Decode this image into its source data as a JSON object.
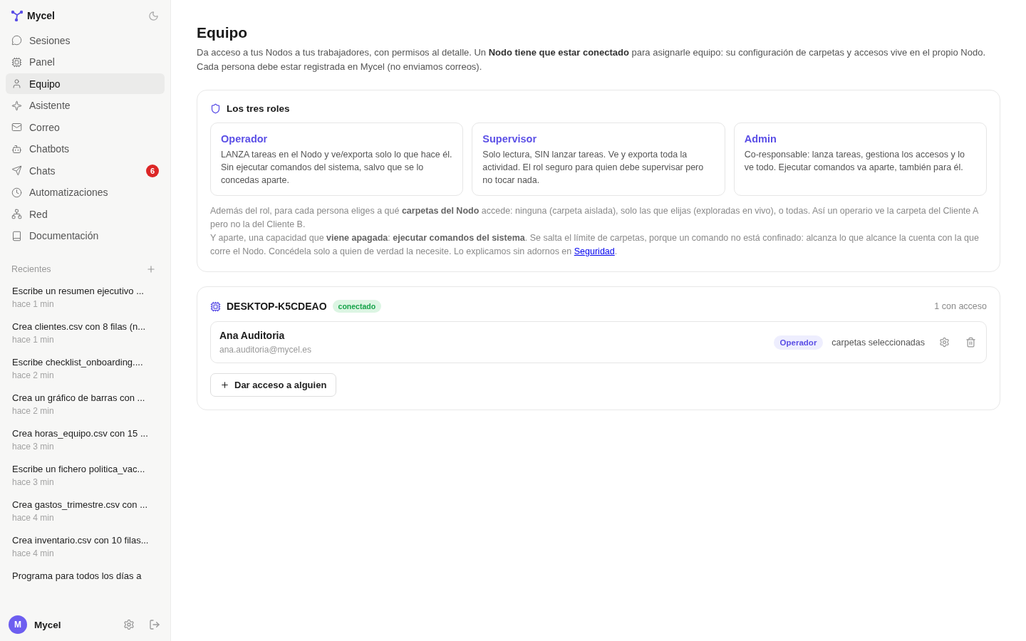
{
  "sidebar": {
    "brand": "Mycel",
    "nav": [
      {
        "label": "Sesiones",
        "selected": false
      },
      {
        "label": "Panel",
        "selected": false
      },
      {
        "label": "Equipo",
        "selected": true
      },
      {
        "label": "Asistente",
        "selected": false
      },
      {
        "label": "Correo",
        "selected": false
      },
      {
        "label": "Chatbots",
        "selected": false
      },
      {
        "label": "Chats",
        "selected": false,
        "badge": "6"
      },
      {
        "label": "Automatizaciones",
        "selected": false
      },
      {
        "label": "Red",
        "selected": false
      },
      {
        "label": "Documentación",
        "selected": false
      }
    ],
    "recent_title": "Recientes",
    "recent": [
      {
        "title": "Escribe un resumen ejecutivo ...",
        "time": "hace 1 min"
      },
      {
        "title": "Crea clientes.csv con 8 filas (n...",
        "time": "hace 1 min"
      },
      {
        "title": "Escribe checklist_onboarding....",
        "time": "hace 2 min"
      },
      {
        "title": "Crea un gráfico de barras con ...",
        "time": "hace 2 min"
      },
      {
        "title": "Crea horas_equipo.csv con 15 ...",
        "time": "hace 3 min"
      },
      {
        "title": "Escribe un fichero politica_vac...",
        "time": "hace 3 min"
      },
      {
        "title": "Crea gastos_trimestre.csv con ...",
        "time": "hace 4 min"
      },
      {
        "title": "Crea inventario.csv con 10 filas...",
        "time": "hace 4 min"
      },
      {
        "title": "Programa para todos los días a"
      }
    ],
    "user": {
      "initial": "M",
      "name": "Mycel"
    }
  },
  "page": {
    "title": "Equipo",
    "intro": "Da acceso a tus Nodos a tus trabajadores, con permisos al detalle. Un **Nodo tiene que estar conectado** para asignarle equipo: su configuración de carpetas y accesos vive en el propio Nodo. Cada persona debe estar registrada en Mycel (no enviamos correos)."
  },
  "roles": {
    "title": "Los tres roles",
    "items": [
      {
        "name": "Operador",
        "description": "LANZA tareas en el Nodo y ve/exporta solo lo que hace él. Sin ejecutar comandos del sistema, salvo que se lo concedas aparte."
      },
      {
        "name": "Supervisor",
        "description": "Solo lectura, SIN lanzar tareas. Ve y exporta toda la actividad. El rol seguro para quien debe supervisar pero no tocar nada."
      },
      {
        "name": "Admin",
        "description": "Co-responsable: lanza tareas, gestiona los accesos y lo ve todo. Ejecutar comandos va aparte, también para él."
      }
    ],
    "note_1": "Además del rol, para cada persona eliges a qué **carpetas del Nodo** accede: ninguna (carpeta aislada), solo las que elijas (exploradas en vivo), o todas. Así un operario ve la carpeta del Cliente A pero no la del Cliente B.",
    "note_2": "Y aparte, una capacidad que **viene apagada**: **ejecutar comandos del sistema**. Se salta el límite de carpetas, porque un comando no está confinado: alcanza lo que alcance la cuenta con la que corre el Nodo. Concédela solo a quien de verdad la necesite. Lo explicamos sin adornos en",
    "note_link": "Seguridad",
    "note_end": "."
  },
  "node": {
    "name": "DESKTOP-K5CDEAO",
    "status": "conectado",
    "connected": true,
    "access_count": "1 con acceso",
    "members": [
      {
        "name": "Ana Auditoria",
        "email": "ana.auditoria@mycel.es",
        "role": "Operador",
        "folders": "carpetas seleccionadas"
      }
    ],
    "add_button": "Dar acceso a alguien"
  }
}
